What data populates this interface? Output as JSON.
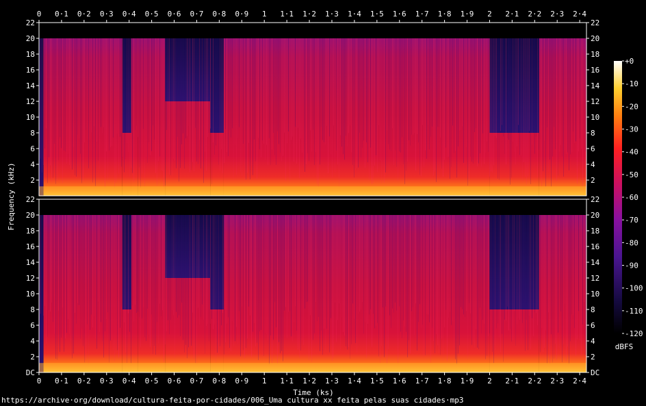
{
  "chart_data": {
    "type": "heatmap",
    "title": "",
    "xlabel": "Time (ks)",
    "ylabel": "Frequency (kHz)",
    "xlim": [
      0,
      2.43
    ],
    "ylim": [
      0,
      22
    ],
    "x_ticks": [
      "0",
      "0·1",
      "0·2",
      "0·3",
      "0·4",
      "0·5",
      "0·6",
      "0·7",
      "0·8",
      "0·9",
      "1",
      "1·1",
      "1·2",
      "1·3",
      "1·4",
      "1·5",
      "1·6",
      "1·7",
      "1·8",
      "1·9",
      "2",
      "2·1",
      "2·2",
      "2·3",
      "2·4"
    ],
    "x_tick_values": [
      0,
      0.1,
      0.2,
      0.3,
      0.4,
      0.5,
      0.6,
      0.7,
      0.8,
      0.9,
      1.0,
      1.1,
      1.2,
      1.3,
      1.4,
      1.5,
      1.6,
      1.7,
      1.8,
      1.9,
      2.0,
      2.1,
      2.2,
      2.3,
      2.4
    ],
    "y_ticks_top": [
      "22",
      "20",
      "18",
      "16",
      "14",
      "12",
      "10",
      "8",
      "6",
      "4",
      "2"
    ],
    "y_ticks_bottom": [
      "22",
      "20",
      "18",
      "16",
      "14",
      "12",
      "10",
      "8",
      "6",
      "4",
      "2",
      "DC"
    ],
    "y_tick_values_top": [
      22,
      20,
      18,
      16,
      14,
      12,
      10,
      8,
      6,
      4,
      2
    ],
    "y_tick_values_bottom": [
      22,
      20,
      18,
      16,
      14,
      12,
      10,
      8,
      6,
      4,
      2,
      0
    ],
    "colorbar": {
      "unit": "dBFS",
      "ticks": [
        "+0",
        "-10",
        "-20",
        "-30",
        "-40",
        "-50",
        "-60",
        "-70",
        "-80",
        "-90",
        "-100",
        "-110",
        "-120"
      ],
      "tick_values": [
        0,
        -10,
        -20,
        -30,
        -40,
        -50,
        -60,
        -70,
        -80,
        -90,
        -100,
        -110,
        -120
      ],
      "range": [
        -120,
        0
      ]
    },
    "channels": 2,
    "cutoff_khz": 20,
    "segments": [
      {
        "start": 0.0,
        "end": 0.02,
        "level": "quiet"
      },
      {
        "start": 0.02,
        "end": 0.37,
        "level": "loud"
      },
      {
        "start": 0.37,
        "end": 0.41,
        "level": "low_cut_8k"
      },
      {
        "start": 0.41,
        "end": 0.44,
        "level": "loud"
      },
      {
        "start": 0.44,
        "end": 0.56,
        "level": "loud"
      },
      {
        "start": 0.56,
        "end": 0.76,
        "level": "mid_cut_12k"
      },
      {
        "start": 0.76,
        "end": 0.82,
        "level": "low_cut_8k"
      },
      {
        "start": 0.82,
        "end": 2.0,
        "level": "loud"
      },
      {
        "start": 2.0,
        "end": 2.22,
        "level": "low_cut_8k"
      },
      {
        "start": 2.22,
        "end": 2.43,
        "level": "loud"
      }
    ]
  },
  "footer": {
    "url": "https://archive·org/download/cultura-feita-por-cidades/006_Uma cultura xx feita pelas suas cidades·mp3"
  },
  "colors": {
    "background": "#000000",
    "quiet": "#1a0f55",
    "mid": "#5a1aa8",
    "loud": "#cc1050",
    "hot": "#ff3a20",
    "base": "#ffd040"
  }
}
